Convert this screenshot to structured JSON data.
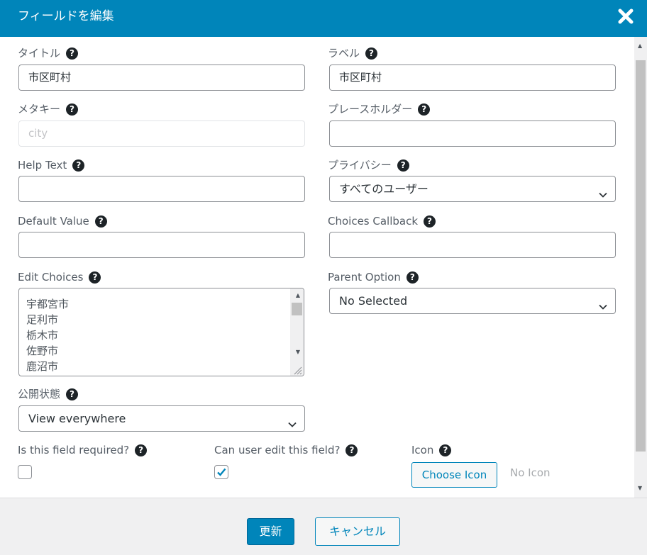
{
  "dialog": {
    "title": "フィールドを編集"
  },
  "fields": {
    "title": {
      "label": "タイトル",
      "value": "市区町村"
    },
    "label": {
      "label": "ラベル",
      "value": "市区町村"
    },
    "meta_key": {
      "label": "メタキー",
      "placeholder": "city"
    },
    "placeholder": {
      "label": "プレースホルダー",
      "value": ""
    },
    "help_text": {
      "label": "Help Text",
      "value": ""
    },
    "privacy": {
      "label": "プライバシー",
      "selected": "すべてのユーザー"
    },
    "default_value": {
      "label": "Default Value",
      "value": ""
    },
    "choices_callback": {
      "label": "Choices Callback",
      "value": ""
    },
    "edit_choices": {
      "label": "Edit Choices",
      "lines": [
        "宇都宮市",
        "足利市",
        "栃木市",
        "佐野市",
        "鹿沼市"
      ]
    },
    "parent_option": {
      "label": "Parent Option",
      "selected": "No Selected"
    },
    "visibility": {
      "label": "公開状態",
      "selected": "View everywhere"
    },
    "required": {
      "label": "Is this field required?",
      "checked": false
    },
    "editable": {
      "label": "Can user edit this field?",
      "checked": true
    },
    "icon": {
      "label": "Icon",
      "button": "Choose Icon",
      "status": "No Icon"
    }
  },
  "help_glyph": "?",
  "icons": {
    "close": "close-icon",
    "help": "help-icon",
    "chevron": "chevron-down-icon",
    "check": "checkmark-icon"
  },
  "footer": {
    "update_label": "更新",
    "cancel_label": "キャンセル"
  },
  "colors": {
    "accent": "#0085ba",
    "footer_bg": "#f0f0f1"
  }
}
